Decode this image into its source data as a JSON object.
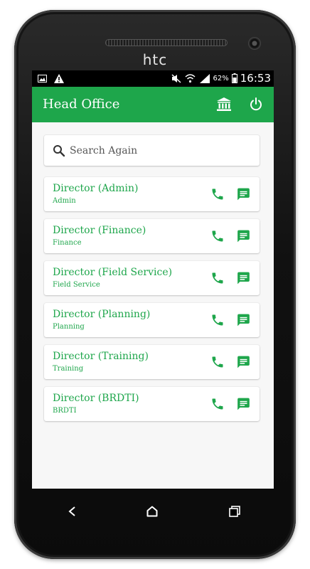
{
  "device": {
    "brand": "htc"
  },
  "status_bar": {
    "left_icons": [
      "image-icon",
      "warning-icon"
    ],
    "right_icons": [
      "mute-icon",
      "wifi-icon",
      "signal-icon"
    ],
    "battery": "62%",
    "time": "16:53"
  },
  "app_bar": {
    "title": "Head Office",
    "actions": [
      "bank-icon",
      "power-icon"
    ],
    "color": "#1ea64b"
  },
  "search": {
    "placeholder": "Search Again"
  },
  "contacts": [
    {
      "title": "Director (Admin)",
      "subtitle": "Admin"
    },
    {
      "title": "Director (Finance)",
      "subtitle": "Finance"
    },
    {
      "title": "Director (Field Service)",
      "subtitle": "Field Service"
    },
    {
      "title": "Director (Planning)",
      "subtitle": "Planning"
    },
    {
      "title": "Director (Training)",
      "subtitle": "Training"
    },
    {
      "title": "Director (BRDTI)",
      "subtitle": "BRDTI"
    }
  ],
  "nav_bar": [
    "back-icon",
    "home-icon",
    "recents-icon"
  ]
}
